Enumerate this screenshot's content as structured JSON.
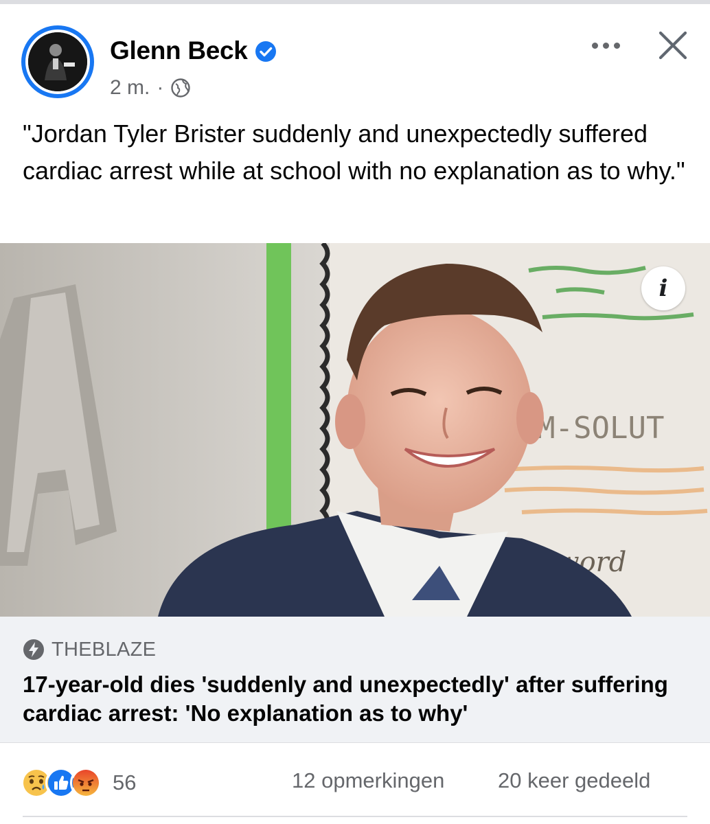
{
  "post": {
    "author": "Glenn Beck",
    "time": "2 m.",
    "separator": "·",
    "text": "\"Jordan Tyler Brister suddenly and unexpectedly suffered cardiac arrest while at school with no explanation as to why.\""
  },
  "image": {
    "info_label": "i",
    "board_text": "M-SOLUT",
    "board_script": "al word"
  },
  "link": {
    "source": "THEBLAZE",
    "headline": "17-year-old dies 'suddenly and unexpectedly' after suffering cardiac arrest: 'No explanation as to why'"
  },
  "footer": {
    "reaction_count": "56",
    "comments": "12 opmerkingen",
    "shares": "20 keer gedeeld"
  },
  "icons": {
    "verified": "verified-badge-icon",
    "audience": "globe-icon",
    "more": "more-dots-icon",
    "close": "close-icon",
    "source": "lightning-bolt-icon",
    "reactions": [
      "sad-reaction-icon",
      "like-reaction-icon",
      "angry-reaction-icon"
    ]
  },
  "colors": {
    "brand_blue": "#1877f2",
    "secondary_text": "#65676b",
    "link_background": "#f0f2f5"
  }
}
